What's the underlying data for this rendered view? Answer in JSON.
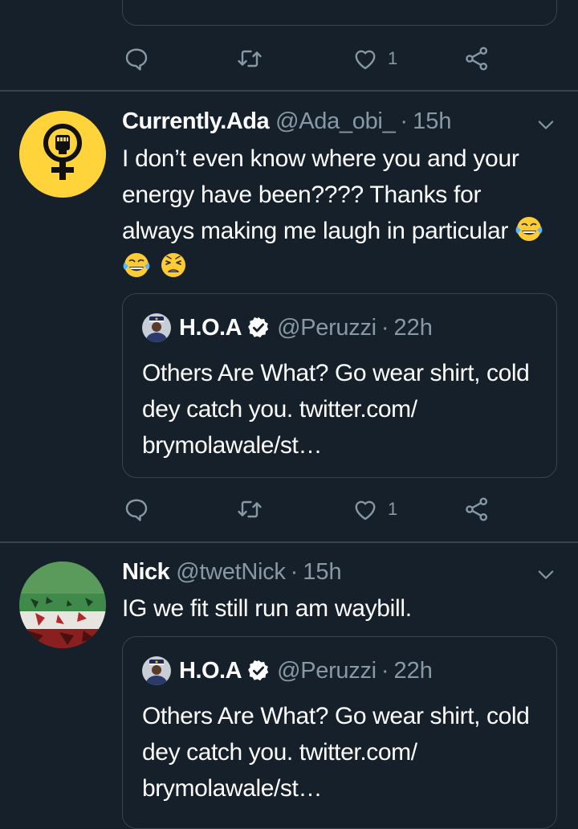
{
  "colors": {
    "background": "#15202b",
    "divider": "#38444d",
    "secondary_text": "#8899a6",
    "primary_text": "#ffffff",
    "verified": "#ffffff",
    "avatar_ada_bg": "#ffd33a"
  },
  "icons": {
    "reply": "reply-icon",
    "retweet": "retweet-icon",
    "like": "heart-icon",
    "share": "share-icon",
    "more": "chevron-down-icon",
    "verified": "verified-badge-icon"
  },
  "top_fragment": {
    "actions": {
      "like_count": "1"
    }
  },
  "tweets": [
    {
      "display_name": "Currently.Ada",
      "handle": "@Ada_obi_",
      "separator": "·",
      "time": "15h",
      "text": "I don’t even know where you and your energy have been???? Thanks for always making me laugh in particular",
      "emojis": [
        "face-with-tears-of-joy",
        "face-with-tears-of-joy",
        "weary-face"
      ],
      "quote": {
        "display_name": "H.O.A",
        "handle": "@Peruzzi",
        "separator": "·",
        "time": "22h",
        "text": "Others Are What? Go wear shirt, cold dey catch you. twitter.com/ brymolawale/st…"
      },
      "actions": {
        "like_count": "1"
      }
    },
    {
      "display_name": "Nick",
      "handle": "@twetNick",
      "separator": "·",
      "time": "15h",
      "text": "IG we fit still run am waybill.",
      "quote": {
        "display_name": "H.O.A",
        "handle": "@Peruzzi",
        "separator": "·",
        "time": "22h",
        "text": "Others Are What? Go wear shirt, cold dey catch you. twitter.com/ brymolawale/st…"
      }
    }
  ]
}
